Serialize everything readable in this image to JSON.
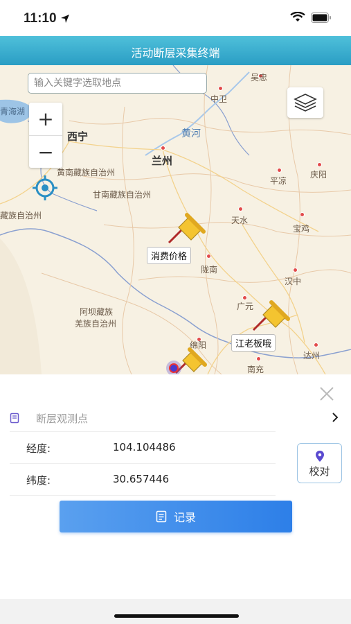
{
  "status": {
    "time": "11:10"
  },
  "header": {
    "title": "活动断层采集终端"
  },
  "map": {
    "search_placeholder": "输入关键字选取地点",
    "zoom_in": "+",
    "zoom_out": "−",
    "labels": {
      "qinghai": "青海湖",
      "xining": "西宁",
      "lanzhou": "兰州",
      "huangnan": "黄南藏族自治州",
      "gannan": "甘南藏族自治州",
      "zangzu": "藏族自治州",
      "huanghe": "黄河",
      "wuzhong": "吴忠",
      "zhongwei": "中卫",
      "pingliang": "平凉",
      "qingyang": "庆阳",
      "tianshui": "天水",
      "baoji": "宝鸡",
      "longnan": "陇南",
      "hanzhong": "汉中",
      "guangyuan": "广元",
      "aba1": "阿坝藏族",
      "aba2": "羌族自治州",
      "mianyang": "绵阳",
      "nanchong": "南充",
      "dazhou": "达州"
    },
    "pins": [
      {
        "label": "消费价格"
      },
      {
        "label": "江老板哦"
      }
    ]
  },
  "panel": {
    "point_placeholder": "断层观测点",
    "longitude_label": "经度:",
    "longitude_value": "104.104486",
    "latitude_label": "纬度:",
    "latitude_value": "30.657446",
    "verify_label": "校对",
    "record_label": "记录"
  },
  "colors": {
    "header": "#2a9dc4",
    "record_button": "#2d7fe8",
    "accent_purple": "#6a5acd"
  }
}
